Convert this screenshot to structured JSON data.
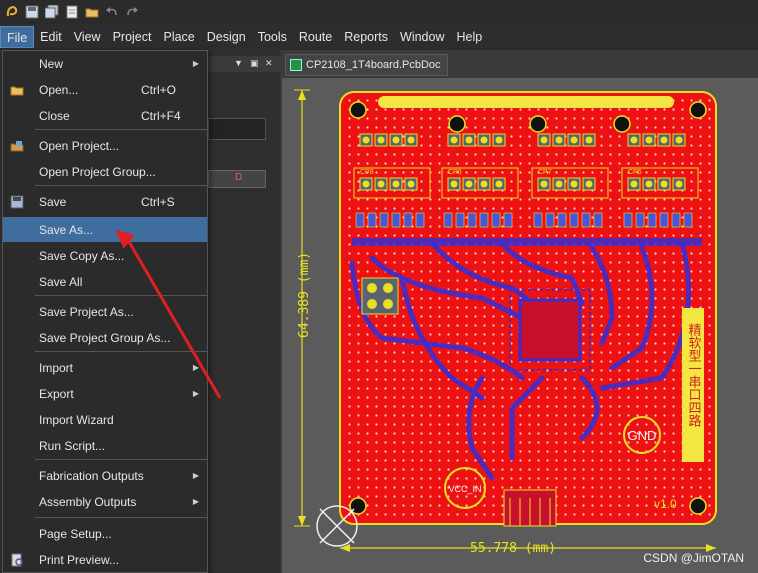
{
  "menubar": {
    "items": [
      "File",
      "Edit",
      "View",
      "Project",
      "Place",
      "Design",
      "Tools",
      "Route",
      "Reports",
      "Window",
      "Help"
    ],
    "underline_index": [
      0,
      0,
      0,
      4,
      0,
      0,
      0,
      2,
      0,
      0,
      0
    ],
    "active": "File"
  },
  "document_tab": {
    "label": "CP2108_1T4board.PcbDoc"
  },
  "left_panel": {
    "field_value": "D"
  },
  "file_menu": [
    {
      "label": "New",
      "shortcut": "",
      "submenu": true,
      "icon": "",
      "highlight": false
    },
    {
      "label": "Open...",
      "shortcut": "Ctrl+O",
      "submenu": false,
      "icon": "folder-open-icon",
      "highlight": false
    },
    {
      "label": "Close",
      "shortcut": "Ctrl+F4",
      "submenu": false,
      "icon": "",
      "highlight": false
    },
    {
      "label": "Open Project...",
      "shortcut": "",
      "submenu": false,
      "icon": "open-project-icon",
      "highlight": false
    },
    {
      "label": "Open Project Group...",
      "shortcut": "",
      "submenu": false,
      "icon": "",
      "highlight": false
    },
    {
      "label": "Save",
      "shortcut": "Ctrl+S",
      "submenu": false,
      "icon": "save-icon",
      "highlight": false
    },
    {
      "label": "Save As...",
      "shortcut": "",
      "submenu": false,
      "icon": "",
      "highlight": true
    },
    {
      "label": "Save Copy As...",
      "shortcut": "",
      "submenu": false,
      "icon": "",
      "highlight": false
    },
    {
      "label": "Save All",
      "shortcut": "",
      "submenu": false,
      "icon": "",
      "highlight": false
    },
    {
      "label": "Save Project As...",
      "shortcut": "",
      "submenu": false,
      "icon": "",
      "highlight": false
    },
    {
      "label": "Save Project Group As...",
      "shortcut": "",
      "submenu": false,
      "icon": "",
      "highlight": false
    },
    {
      "label": "Import",
      "shortcut": "",
      "submenu": true,
      "icon": "",
      "highlight": false
    },
    {
      "label": "Export",
      "shortcut": "",
      "submenu": true,
      "icon": "",
      "highlight": false
    },
    {
      "label": "Import Wizard",
      "shortcut": "",
      "submenu": false,
      "icon": "",
      "highlight": false
    },
    {
      "label": "Run Script...",
      "shortcut": "",
      "submenu": false,
      "icon": "",
      "highlight": false
    },
    {
      "label": "Fabrication Outputs",
      "shortcut": "",
      "submenu": true,
      "icon": "",
      "highlight": false
    },
    {
      "label": "Assembly Outputs",
      "shortcut": "",
      "submenu": true,
      "icon": "",
      "highlight": false
    },
    {
      "label": "Page Setup...",
      "shortcut": "",
      "submenu": false,
      "icon": "",
      "highlight": false
    },
    {
      "label": "Print Preview...",
      "shortcut": "",
      "submenu": false,
      "icon": "print-preview-icon",
      "highlight": false
    }
  ],
  "pcb": {
    "dim_vertical": "64.389 (mm)",
    "dim_horizontal": "55.778 (mm)",
    "gnd_label": "GND",
    "vcc_label": "VCC_IN",
    "version_label": "v1.0",
    "chip_labels": [
      "CP8",
      "CP6",
      "CP7",
      "CP5"
    ],
    "side_text": "精软型一串口四路",
    "colors": {
      "board": "#ee1111",
      "silk": "#e8e020",
      "trace": "#3a2ed0",
      "outline": "#e8e020"
    }
  },
  "watermark": "CSDN @JimOTAN",
  "annotation": {
    "arrow_color": "#e02020"
  }
}
